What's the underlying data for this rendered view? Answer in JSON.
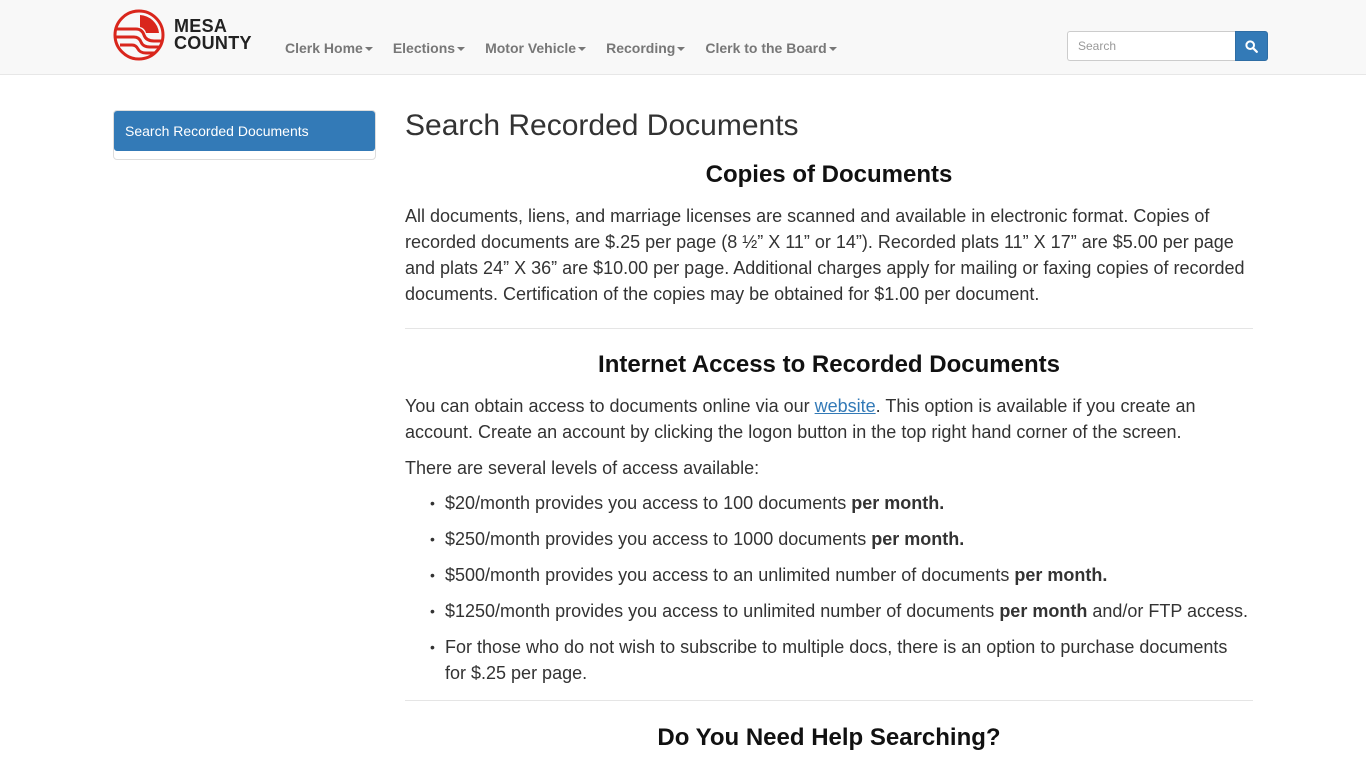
{
  "brand": {
    "line1": "MESA",
    "line2": "COUNTY",
    "logo_color": "#d9261c"
  },
  "nav": {
    "items": [
      {
        "label": "Clerk Home"
      },
      {
        "label": "Elections"
      },
      {
        "label": "Motor Vehicle"
      },
      {
        "label": "Recording"
      },
      {
        "label": "Clerk to the Board"
      }
    ],
    "search_placeholder": "Search",
    "search_icon": "magnifier-icon"
  },
  "sidebar": {
    "items": [
      {
        "label": "Search Recorded Documents",
        "active": true
      }
    ]
  },
  "main": {
    "title": "Search Recorded Documents",
    "copies": {
      "heading": "Copies of Documents",
      "text": "All documents, liens, and marriage licenses are scanned and available in electronic format. Copies of recorded documents are $.25 per page (8 ½” X 11” or 14”). Recorded plats 11” X 17” are $5.00 per page and plats 24” X 36” are $10.00 per page. Additional charges apply for mailing or faxing copies of recorded documents. Certification of the copies may be obtained for $1.00 per document."
    },
    "internet": {
      "heading": "Internet Access to Recorded Documents",
      "intro_before": "You can obtain access to documents online via our ",
      "link_text": "website",
      "intro_after": ".  This option is available if you create an account.  Create an account by clicking the logon button in the top right hand corner of the screen.",
      "levels_intro": "There are several levels of access available:",
      "levels": [
        {
          "text": "$20/month provides you access to 100 documents ",
          "bold": "per month.",
          "tail": ""
        },
        {
          "text": "$250/month provides you access to 1000 documents ",
          "bold": "per month.",
          "tail": ""
        },
        {
          "text": "$500/month provides you access to an unlimited number of documents ",
          "bold": "per month.",
          "tail": ""
        },
        {
          "text": "$1250/month provides you access to unlimited number of documents ",
          "bold": "per month",
          "tail": " and/or FTP access."
        },
        {
          "text": "For those who do not wish to subscribe to multiple docs, there is an option to purchase documents for $.25 per page.",
          "bold": "",
          "tail": ""
        }
      ]
    },
    "help": {
      "heading": "Do You Need Help Searching?"
    }
  },
  "colors": {
    "primary": "#337ab7",
    "navbar_bg": "#f8f8f8",
    "nav_text": "#777777"
  }
}
